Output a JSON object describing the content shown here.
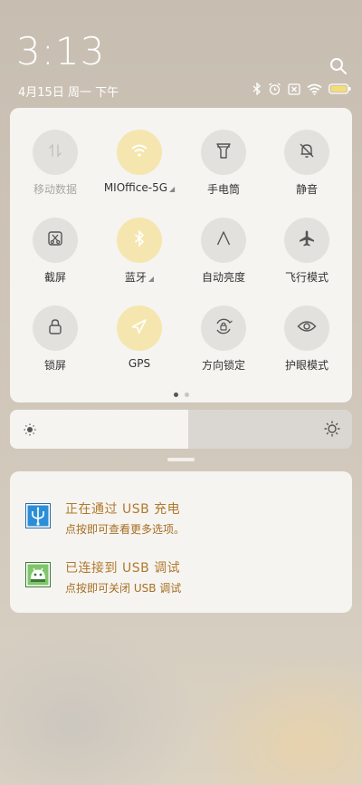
{
  "status": {
    "time": "3:13",
    "date": "4月15日 周一 下午",
    "icons": [
      "bluetooth-icon",
      "alarm-icon",
      "sim-disabled-icon",
      "wifi-icon",
      "battery-icon"
    ]
  },
  "quick_settings": {
    "tiles": [
      {
        "label": "移动数据",
        "icon": "mobile-data-icon",
        "active": false,
        "dim": true,
        "caret": false
      },
      {
        "label": "MIOffice-5G",
        "icon": "wifi-icon",
        "active": true,
        "dim": false,
        "caret": true
      },
      {
        "label": "手电筒",
        "icon": "flashlight-icon",
        "active": false,
        "dim": false,
        "caret": false
      },
      {
        "label": "静音",
        "icon": "mute-bell-icon",
        "active": false,
        "dim": false,
        "caret": false
      },
      {
        "label": "截屏",
        "icon": "screenshot-icon",
        "active": false,
        "dim": false,
        "caret": false
      },
      {
        "label": "蓝牙",
        "icon": "bluetooth-icon",
        "active": true,
        "dim": false,
        "caret": true
      },
      {
        "label": "自动亮度",
        "icon": "auto-brightness-icon",
        "active": false,
        "dim": false,
        "caret": false
      },
      {
        "label": "飞行模式",
        "icon": "airplane-icon",
        "active": false,
        "dim": false,
        "caret": false
      },
      {
        "label": "锁屏",
        "icon": "lock-icon",
        "active": false,
        "dim": false,
        "caret": false
      },
      {
        "label": "GPS",
        "icon": "gps-icon",
        "active": true,
        "dim": false,
        "caret": false
      },
      {
        "label": "方向锁定",
        "icon": "rotation-lock-icon",
        "active": false,
        "dim": false,
        "caret": false
      },
      {
        "label": "护眼模式",
        "icon": "eye-icon",
        "active": false,
        "dim": false,
        "caret": false
      }
    ],
    "page_count": 2,
    "current_page": 1
  },
  "brightness": {
    "level": 0.52
  },
  "notifications": [
    {
      "title": "正在通过 USB 充电",
      "subtitle": "点按即可查看更多选项。",
      "icon": "usb-icon"
    },
    {
      "title": "已连接到 USB 调试",
      "subtitle": "点按即可关闭 USB 调试",
      "icon": "android-icon"
    }
  ],
  "colors": {
    "active_tile": "#f4e6ae",
    "inactive_tile": "#e3e1dd",
    "notif_text": "#b07a2c"
  }
}
